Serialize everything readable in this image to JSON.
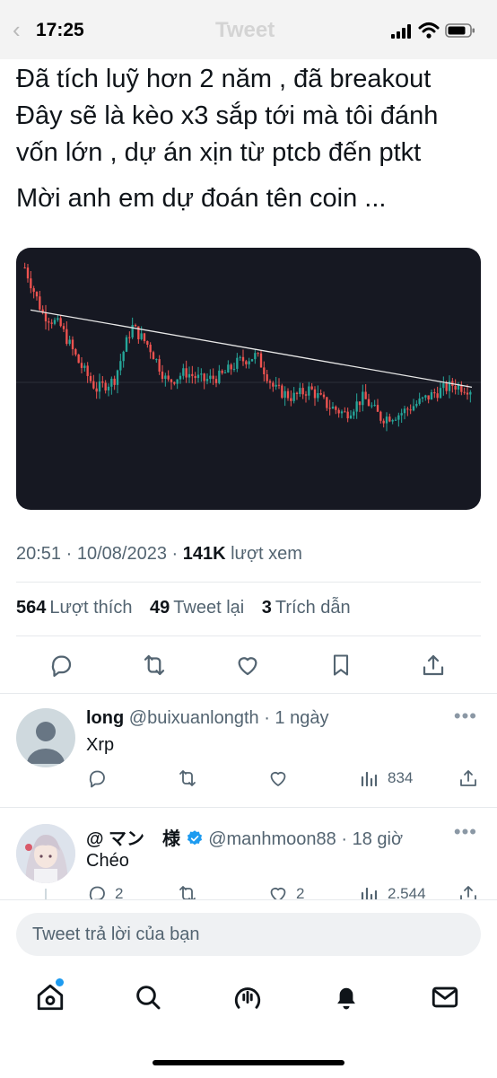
{
  "status_bar": {
    "time": "17:25",
    "back_glyph": "‹",
    "faded_title": "Tweet"
  },
  "tweet": {
    "lines": [
      "Đã tích luỹ hơn 2 năm , đã breakout",
      "Đây sẽ là kèo x3 sắp tới mà tôi đánh",
      "vốn lớn , dự án xịn từ ptcb đến ptkt"
    ],
    "question": "Mời anh em dự đoán tên coin ...",
    "time": "20:51",
    "date": "10/08/2023",
    "views_count": "141K",
    "views_label": "lượt xem",
    "likes_count": "564",
    "likes_label": "Lượt thích",
    "retweets_count": "49",
    "retweets_label": "Tweet lại",
    "quotes_count": "3",
    "quotes_label": "Trích dẫn"
  },
  "replies": [
    {
      "display_name": "long",
      "handle": "@buixuanlongth",
      "time": "1 ngày",
      "text": "Xrp",
      "views": "834",
      "replies": "",
      "likes": ""
    },
    {
      "display_name": "@ マン　様",
      "handle": "@manhmoon88",
      "time": "18 giờ",
      "text": "Chéo",
      "replies": "2",
      "likes": "2",
      "views": "2.544"
    }
  ],
  "compose": {
    "placeholder": "Tweet trả lời của bạn"
  },
  "icons": {
    "reply": "reply-icon",
    "retweet": "retweet-icon",
    "like": "heart-icon",
    "bookmark": "bookmark-icon",
    "share": "share-icon",
    "views": "views-icon",
    "more": "more-icon",
    "verified": "verified-badge-icon",
    "home": "home-icon",
    "search": "search-icon",
    "spaces": "spaces-icon",
    "notifications": "bell-icon",
    "messages": "mail-icon"
  },
  "colors": {
    "chart_bg": "#161822",
    "candle_up": "#26a69a",
    "candle_down": "#ef5350",
    "trendline": "#e8e8e8",
    "accent": "#1d9bf0",
    "text_secondary": "#536471"
  },
  "chart_data": {
    "type": "candlestick",
    "title": "",
    "xlabel": "",
    "ylabel": "",
    "description_values_relative": [
      1.0,
      0.78,
      0.72,
      0.55,
      0.42,
      0.46,
      0.72,
      0.62,
      0.45,
      0.5,
      0.46,
      0.48,
      0.55,
      0.58,
      0.42,
      0.38,
      0.42,
      0.34,
      0.3,
      0.38,
      0.28,
      0.3,
      0.35,
      0.4,
      0.44,
      0.42
    ],
    "trendline": "descending",
    "grid": false
  }
}
